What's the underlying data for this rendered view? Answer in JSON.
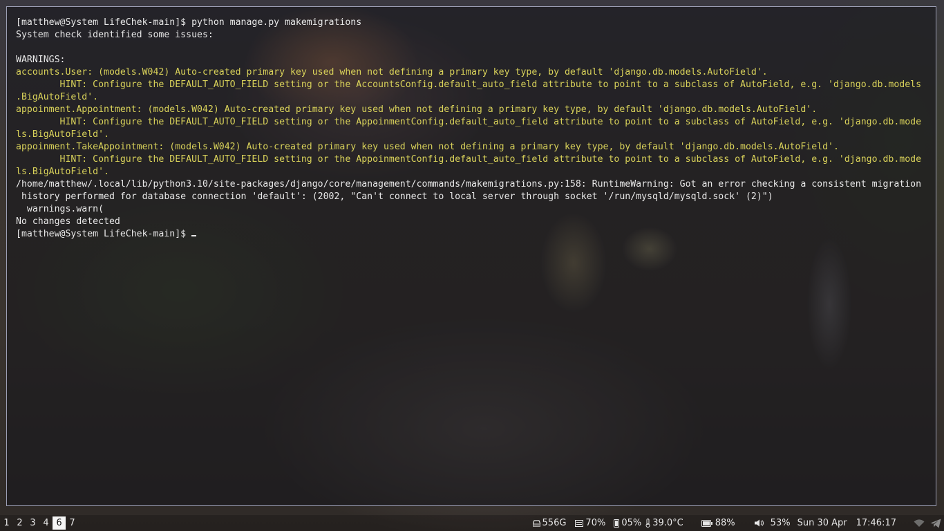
{
  "terminal": {
    "lines": [
      {
        "text": "[matthew@System LifeChek-main]$ python manage.py makemigrations",
        "kind": "normal"
      },
      {
        "text": "System check identified some issues:",
        "kind": "normal"
      },
      {
        "text": "",
        "kind": "normal"
      },
      {
        "text": "WARNINGS:",
        "kind": "normal"
      },
      {
        "text": "accounts.User: (models.W042) Auto-created primary key used when not defining a primary key type, by default 'django.db.models.AutoField'.",
        "kind": "warn"
      },
      {
        "text": "        HINT: Configure the DEFAULT_AUTO_FIELD setting or the AccountsConfig.default_auto_field attribute to point to a subclass of AutoField, e.g. 'django.db.models",
        "kind": "warn"
      },
      {
        "text": ".BigAutoField'.",
        "kind": "warn"
      },
      {
        "text": "appoinment.Appointment: (models.W042) Auto-created primary key used when not defining a primary key type, by default 'django.db.models.AutoField'.",
        "kind": "warn"
      },
      {
        "text": "        HINT: Configure the DEFAULT_AUTO_FIELD setting or the AppoinmentConfig.default_auto_field attribute to point to a subclass of AutoField, e.g. 'django.db.mode",
        "kind": "warn"
      },
      {
        "text": "ls.BigAutoField'.",
        "kind": "warn"
      },
      {
        "text": "appoinment.TakeAppointment: (models.W042) Auto-created primary key used when not defining a primary key type, by default 'django.db.models.AutoField'.",
        "kind": "warn"
      },
      {
        "text": "        HINT: Configure the DEFAULT_AUTO_FIELD setting or the AppoinmentConfig.default_auto_field attribute to point to a subclass of AutoField, e.g. 'django.db.mode",
        "kind": "warn"
      },
      {
        "text": "ls.BigAutoField'.",
        "kind": "warn"
      },
      {
        "text": "/home/matthew/.local/lib/python3.10/site-packages/django/core/management/commands/makemigrations.py:158: RuntimeWarning: Got an error checking a consistent migration",
        "kind": "normal"
      },
      {
        "text": " history performed for database connection 'default': (2002, \"Can't connect to local server through socket '/run/mysqld/mysqld.sock' (2)\")",
        "kind": "normal"
      },
      {
        "text": "  warnings.warn(",
        "kind": "normal"
      },
      {
        "text": "No changes detected",
        "kind": "normal"
      }
    ],
    "prompt": "[matthew@System LifeChek-main]$ ",
    "colors": {
      "text": "#e8e8e8",
      "warning": "#d9d25a",
      "border": "#9c9fb5"
    }
  },
  "statusbar": {
    "workspaces": [
      {
        "label": "1",
        "active": false
      },
      {
        "label": "2",
        "active": false
      },
      {
        "label": "3",
        "active": false
      },
      {
        "label": "4",
        "active": false
      },
      {
        "label": "6",
        "active": true
      },
      {
        "label": "7",
        "active": false
      }
    ],
    "disk": {
      "icon": "disk-icon",
      "value": "556G"
    },
    "memory": {
      "icon": "memory-icon",
      "value": "70%"
    },
    "swap": {
      "icon": "swap-icon",
      "value": "05%"
    },
    "temperature": {
      "icon": "thermometer-icon",
      "value": "39.0°C"
    },
    "battery": {
      "icon": "battery-icon",
      "value": "88%"
    },
    "volume": {
      "icon": "speaker-icon",
      "value": "53%"
    },
    "date": "Sun 30 Apr",
    "time": "17:46:17",
    "tray": [
      "wifi-icon",
      "telegram-icon"
    ]
  }
}
